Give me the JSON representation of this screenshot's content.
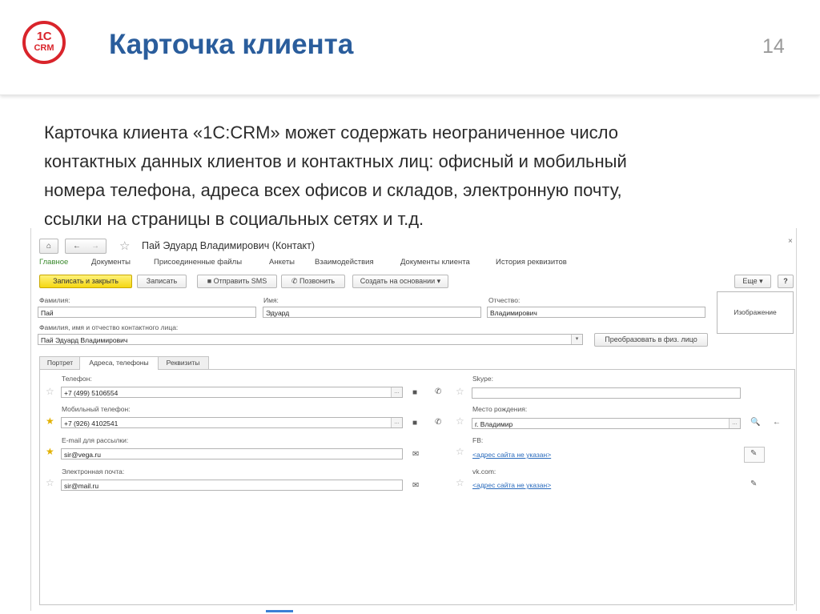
{
  "slide": {
    "logo_top": "1С",
    "logo_bottom": "CRM",
    "title": "Карточка клиента",
    "page_number": "14",
    "intro_lines": [
      "Карточка клиента «1С:CRM» может содержать неограниченное число",
      "контактных данных клиентов и контактных лиц: офисный и мобильный",
      "номера телефона, адреса всех офисов и складов, электронную почту,",
      "ссылки на страницы в социальных сетях и т.д."
    ]
  },
  "window": {
    "title": "Пай Эдуард Владимирович (Контакт)",
    "home_icon": "⌂",
    "back_icon": "←",
    "forward_icon": "→",
    "favorite_icon": "☆",
    "close_icon": "×"
  },
  "menu": [
    {
      "label": "Главное",
      "active": true
    },
    {
      "label": "Документы"
    },
    {
      "label": "Присоединенные файлы"
    },
    {
      "label": "Анкеты"
    },
    {
      "label": "Взаимодействия"
    },
    {
      "label": "Документы клиента"
    },
    {
      "label": "История реквизитов"
    }
  ],
  "toolbar": {
    "save_close": "Записать и закрыть",
    "save": "Записать",
    "send_sms": "Отправить SMS",
    "call": "Позвонить",
    "create_based": "Создать на основании",
    "more": "Еще",
    "help": "?"
  },
  "fields": {
    "last_name_label": "Фамилия:",
    "last_name": "Пай",
    "first_name_label": "Имя:",
    "first_name": "Эдуард",
    "patronymic_label": "Отчество:",
    "patronymic": "Владимирович",
    "fullname_label": "Фамилия, имя и отчество контактного лица:",
    "fullname": "Пай Эдуард Владимирович",
    "convert_button": "Преобразовать в физ. лицо",
    "image_label": "Изображение"
  },
  "tabs": [
    "Портрет",
    "Адреса, телефоны",
    "Реквизиты"
  ],
  "contacts_left": [
    {
      "label": "Телефон:",
      "value": "+7 (499) 5106554",
      "starred": false
    },
    {
      "label": "Мобильный телефон:",
      "value": "+7 (926) 4102541",
      "starred": true
    },
    {
      "label": "E-mail для рассылки:",
      "value": "sir@vega.ru",
      "starred": true
    },
    {
      "label": "Электронная почта:",
      "value": "sir@mail.ru",
      "starred": false
    }
  ],
  "contacts_right": {
    "skype_label": "Skype:",
    "skype_value": "",
    "birthplace_label": "Место рождения:",
    "birthplace_value": "г. Владимир",
    "fb_label": "FB:",
    "fb_link": "<адрес сайта не указан>",
    "vk_label": "vk.com:",
    "vk_link": "<адрес сайта не указан>"
  },
  "icons": {
    "more_icon": "…",
    "dropdown_icon": "▾",
    "video_icon": "■",
    "phone_icon": "✆",
    "mail_icon": "✉",
    "search_icon": "🔍",
    "arrow_left_icon": "←",
    "pencil_icon": "✎"
  },
  "colors": {
    "title_blue": "#2a5d9c",
    "logo_red": "#d9242b",
    "menu_active_green": "#3b8a2e",
    "primary_yellow": "#f5d711",
    "link_blue": "#2a6bbd",
    "star_gold": "#e2b100"
  }
}
